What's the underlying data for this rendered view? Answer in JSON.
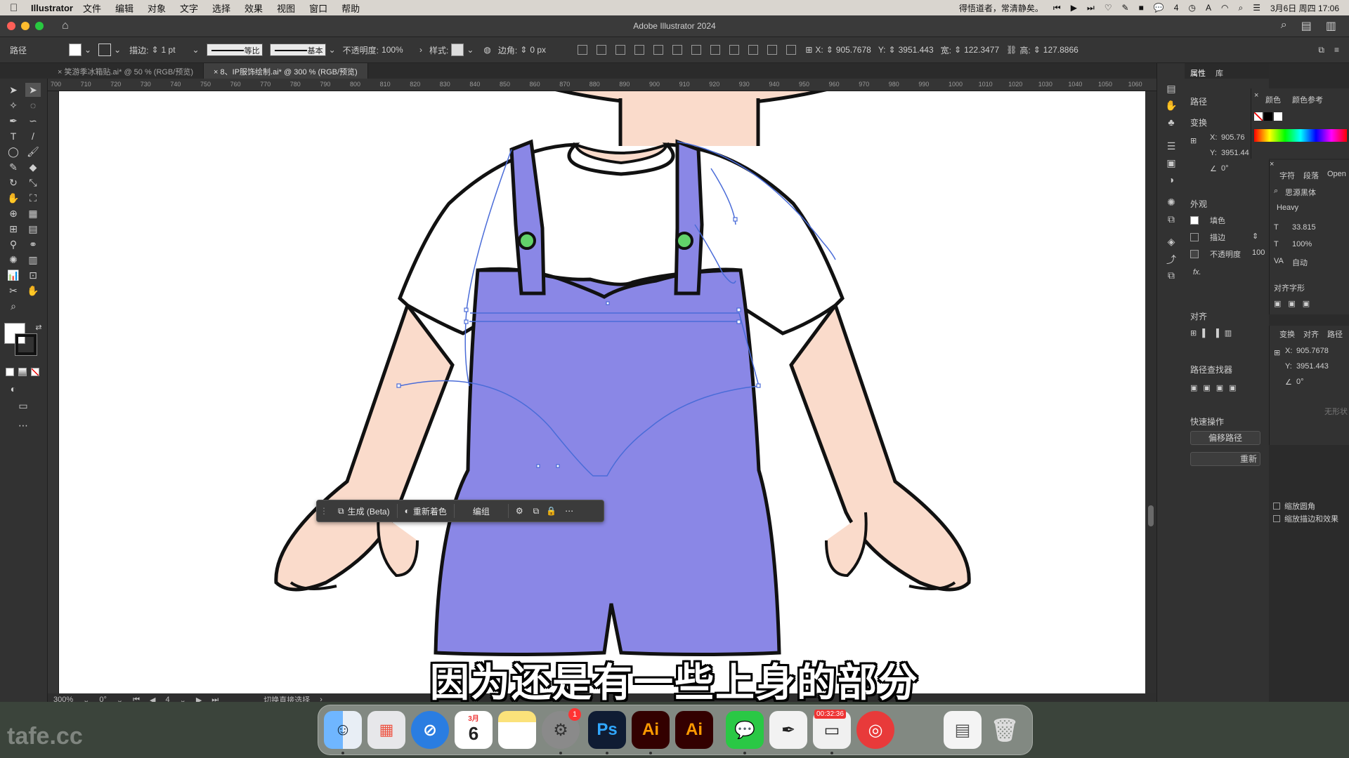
{
  "menubar": {
    "app_name": "Illustrator",
    "items": [
      "文件",
      "编辑",
      "对象",
      "文字",
      "选择",
      "效果",
      "视图",
      "窗口",
      "帮助"
    ],
    "status_text": "得悟道者，常清静矣。",
    "wechat_count": "4",
    "datetime": "3月6日 周四 17:06"
  },
  "window": {
    "title": "Adobe Illustrator 2024"
  },
  "control_bar": {
    "object_type": "路径",
    "stroke_label": "描边:",
    "stroke_value": "1 pt",
    "stroke_profile": "等比",
    "brush_profile": "基本",
    "opacity_label": "不透明度:",
    "opacity_value": "100%",
    "style_label": "样式:",
    "corner_label": "边角:",
    "corner_value": "0 px",
    "x_label": "X:",
    "x_value": "905.7678",
    "y_label": "Y:",
    "y_value": "3951.443",
    "w_label": "宽:",
    "w_value": "122.3477",
    "h_label": "高:",
    "h_value": "127.8866"
  },
  "tabs": [
    {
      "label": "笑游季冰箱贴.ai* @ 50 % (RGB/预览)"
    },
    {
      "label": "8、IP服饰绘制.ai* @ 300 % (RGB/预览)"
    }
  ],
  "ruler_labels": [
    "700",
    "710",
    "720",
    "730",
    "740",
    "750",
    "760",
    "770",
    "780",
    "790",
    "800",
    "810",
    "820",
    "830",
    "840",
    "850",
    "860",
    "870",
    "880",
    "890",
    "900",
    "910",
    "920",
    "930",
    "940",
    "950",
    "960",
    "970",
    "980",
    "990",
    "1000",
    "1010",
    "1020",
    "1030",
    "1040",
    "1050",
    "1060"
  ],
  "status_bar": {
    "zoom": "300%",
    "rotation": "0°",
    "artboard_num": "4",
    "tool_hint": "切换直接选择"
  },
  "context_taskbar": {
    "generate": "生成 (Beta)",
    "recolor": "重新着色",
    "group": "编组"
  },
  "subtitle": "因为还是有一些上身的部分",
  "properties_panel": {
    "tabs": [
      "属性",
      "库"
    ],
    "section_object": "路径",
    "section_transform": "变换",
    "x_label": "X:",
    "x_value": "905.76",
    "y_label": "Y:",
    "y_value": "3951.44",
    "angle_value": "0°",
    "section_appearance": "外观",
    "fill_label": "填色",
    "stroke_label": "描边",
    "opacity_label": "不透明度",
    "opacity_value": "100",
    "fx_label": "fx.",
    "section_align": "对齐",
    "section_pathfinder": "路径查找器",
    "section_quick": "快速操作",
    "offset_path_button": "偏移路径",
    "reset_button": "重新"
  },
  "color_panel": {
    "tabs": [
      "颜色",
      "颜色参考"
    ]
  },
  "character_panel": {
    "tabs": [
      "字符",
      "段落",
      "Open"
    ],
    "font_family": "思源黑体",
    "font_style": "Heavy",
    "font_size": "33.815",
    "scale": "100%",
    "leading": "自动",
    "align_glyph_title": "对齐字形"
  },
  "transform_panel": {
    "tabs": [
      "变换",
      "对齐",
      "路径"
    ],
    "x_value": "905.7678",
    "y_value": "3951.443",
    "angle_value": "0°",
    "shape_hint": "无形状",
    "scale_corners": "缩放圆角",
    "scale_strokes": "缩放描边和效果"
  },
  "dock": {
    "calendar_month": "3月",
    "calendar_day": "6",
    "settings_badge": "1",
    "ps_label": "Ps",
    "ai_label": "Ai",
    "ai2_label": "Ai",
    "recording_time": "00:32:36"
  },
  "watermark": "tafe.cc",
  "colors": {
    "overall": "#8a87e6",
    "skin": "#fadbcb",
    "button_green": "#62d36a",
    "selection_blue": "#4a6cd8",
    "outline": "#111111"
  }
}
